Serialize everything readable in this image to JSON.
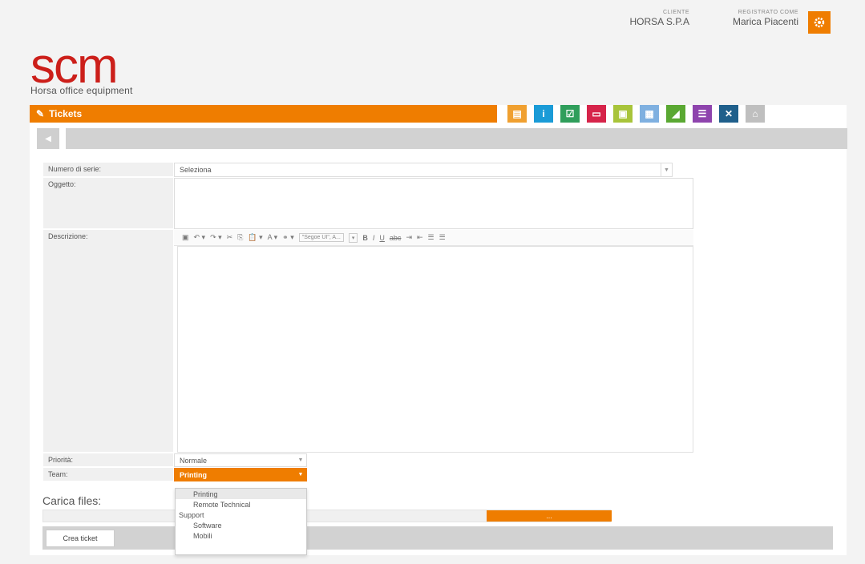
{
  "header": {
    "client_caption": "CLIENTE",
    "client_name": "HORSA S.P.A",
    "user_caption": "REGISTRATO COME",
    "user_name": "Marica Piacenti"
  },
  "logo": {
    "text": "scm",
    "subtitle": "Horsa office equipment"
  },
  "title_bar": {
    "title": "Tickets"
  },
  "toolbar_icons": [
    {
      "name": "folder-doc-icon",
      "color": "#f0a030",
      "glyph": "▤"
    },
    {
      "name": "info-icon",
      "color": "#1a9bd7",
      "glyph": "i"
    },
    {
      "name": "checklist-icon",
      "color": "#2f9e5b",
      "glyph": "☑"
    },
    {
      "name": "folder-icon",
      "color": "#d6244a",
      "glyph": "▭"
    },
    {
      "name": "document-icon",
      "color": "#a8c43a",
      "glyph": "▣"
    },
    {
      "name": "form-icon",
      "color": "#7fb0e0",
      "glyph": "▦"
    },
    {
      "name": "chart-icon",
      "color": "#5aa832",
      "glyph": "◢"
    },
    {
      "name": "list-icon",
      "color": "#8e44ad",
      "glyph": "☰"
    },
    {
      "name": "tools-icon",
      "color": "#1f5f8b",
      "glyph": "✕"
    },
    {
      "name": "home-icon",
      "color": "#bfbfbf",
      "glyph": "⌂"
    }
  ],
  "form": {
    "serial_label": "Numero di serie:",
    "serial_value": "Seleziona",
    "subject_label": "Oggetto:",
    "description_label": "Descrizione:",
    "editor_font": "\"Segoe UI\", A...",
    "editor_buttons": [
      "B",
      "I",
      "U",
      "abc"
    ],
    "priority_label": "Priorità:",
    "priority_value": "Normale",
    "team_label": "Team:",
    "team_value": "Printing",
    "team_options": [
      {
        "label": "Printing",
        "type": "item",
        "selected": true
      },
      {
        "label": "Remote Technical",
        "type": "item"
      },
      {
        "label": "Support",
        "type": "group"
      },
      {
        "label": "Software",
        "type": "item"
      },
      {
        "label": "Mobili",
        "type": "item"
      }
    ],
    "upload_label": "Carica files:",
    "upload_button": "...",
    "create_button": "Crea ticket"
  },
  "colors": {
    "accent": "#ef7d00",
    "logo_red": "#cc1f1a"
  }
}
